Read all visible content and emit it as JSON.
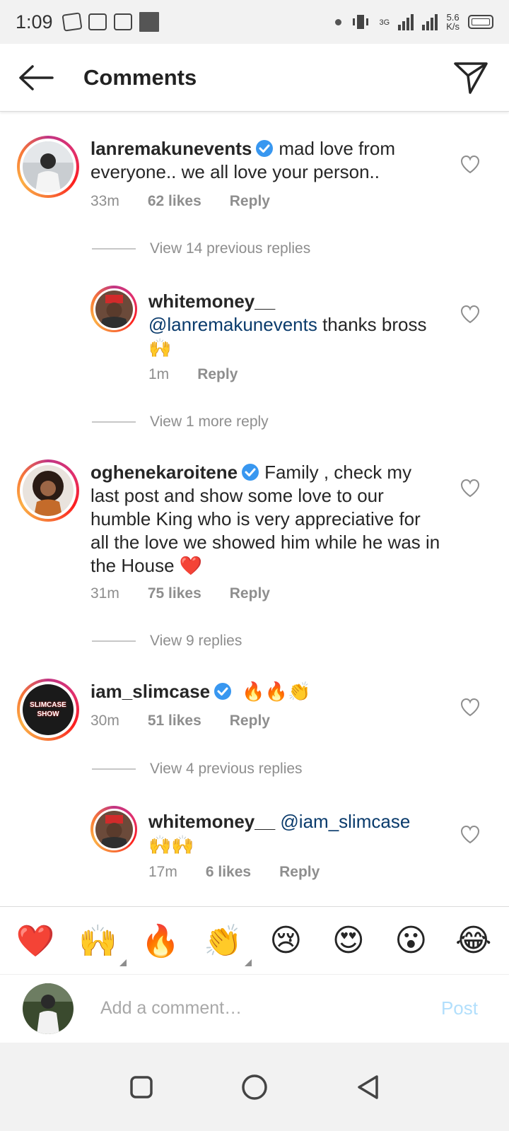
{
  "status_bar": {
    "time": "1:09",
    "speed_value": "5.6",
    "speed_unit": "K/s",
    "network": "3G"
  },
  "header": {
    "title": "Comments"
  },
  "comments": [
    {
      "user": "lanremakunevents",
      "verified": true,
      "text": "mad love from everyone.. we all love your person..",
      "time": "33m",
      "likes": "62 likes",
      "reply": "Reply"
    },
    {
      "view_label": "View 14 previous replies"
    },
    {
      "user": "whitemoney__",
      "mention": "@lanremakunevents",
      "text": " thanks bross",
      "emoji": "🙌",
      "time": "1m",
      "reply": "Reply"
    },
    {
      "view_label": "View 1 more reply"
    },
    {
      "user": "oghenekaroitene",
      "verified": true,
      "text": "Family , check my last post and show some love to our humble King who is very appreciative for all the love we showed him while he was in the House",
      "emoji": "❤️",
      "time": "31m",
      "likes": "75 likes",
      "reply": "Reply"
    },
    {
      "view_label": "View 9 replies"
    },
    {
      "user": "iam_slimcase",
      "verified": true,
      "emoji": "🔥🔥👏",
      "time": "30m",
      "likes": "51 likes",
      "reply": "Reply",
      "avatar_text": "SLIMCASE SHOW"
    },
    {
      "view_label": "View 4 previous replies"
    },
    {
      "user": "whitemoney__",
      "mention": "@iam_slimcase",
      "emoji": "🙌🙌",
      "time": "17m",
      "likes": "6 likes",
      "reply": "Reply"
    }
  ],
  "emoji_bar": [
    "❤️",
    "🙌",
    "🔥",
    "👏",
    "😢",
    "😍",
    "😮",
    "😂"
  ],
  "composer": {
    "placeholder": "Add a comment…",
    "post_label": "Post"
  },
  "colors": {
    "mention": "#0a3b6c",
    "verified": "#3897f0",
    "post_disabled": "#b2dffc",
    "meta": "#8e8e8e"
  }
}
